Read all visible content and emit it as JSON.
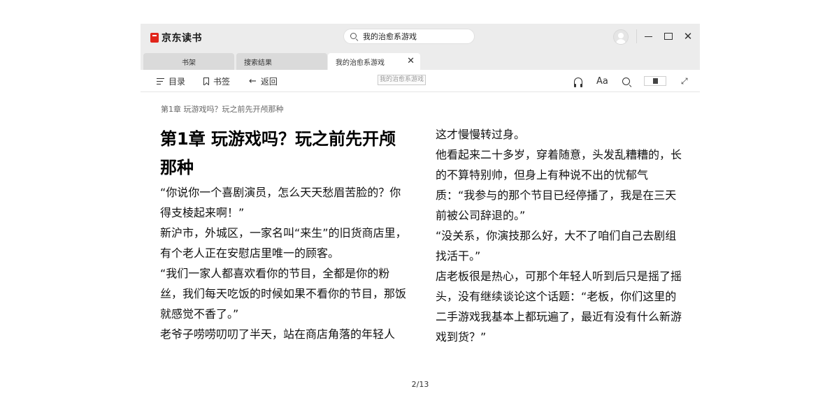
{
  "app": {
    "logo_text": "京东读书",
    "brand_color": "#e1251b"
  },
  "search": {
    "value": "我的治愈系游戏"
  },
  "tabs": [
    {
      "label": "书架"
    },
    {
      "label": "搜索结果"
    },
    {
      "label": "我的治愈系游戏",
      "active": true
    }
  ],
  "toolbar": {
    "toc_label": "目录",
    "bookmark_label": "书签",
    "back_label": "返回",
    "tooltip": "我的治愈系游戏",
    "font_label": "Aa"
  },
  "reader": {
    "chapter_crumb": "第1章 玩游戏吗？玩之前先开颅那种",
    "chapter_title": "第1章 玩游戏吗？玩之前先开颅那种",
    "left_paragraphs": [
      "“你说你一个喜剧演员，怎么天天愁眉苦脸的？你得支棱起来啊！”",
      "新沪市，外城区，一家名叫“来生”的旧货商店里，有个老人正在安慰店里唯一的顾客。",
      "“我们一家人都喜欢看你的节目，全都是你的粉丝，我们每天吃饭的时候如果不看你的节目，那饭就感觉不香了。”",
      "老爷子唠唠叨叨了半天，站在商店角落的年轻人"
    ],
    "right_paragraphs": [
      "这才慢慢转过身。",
      "他看起来二十多岁，穿着随意，头发乱糟糟的，长的不算特别帅，但身上有种说不出的忧郁气质：“我参与的那个节目已经停播了，我是在三天前被公司辞退的。”",
      "“没关系，你演技那么好，大不了咱们自己去剧组找活干。”",
      "店老板很是热心，可那个年轻人听到后只是摇了摇头，没有继续谈论这个话题：“老板，你们这里的二手游戏我基本上都玩遍了，最近有没有什么新游戏到货？”"
    ],
    "page_indicator": "2/13"
  }
}
